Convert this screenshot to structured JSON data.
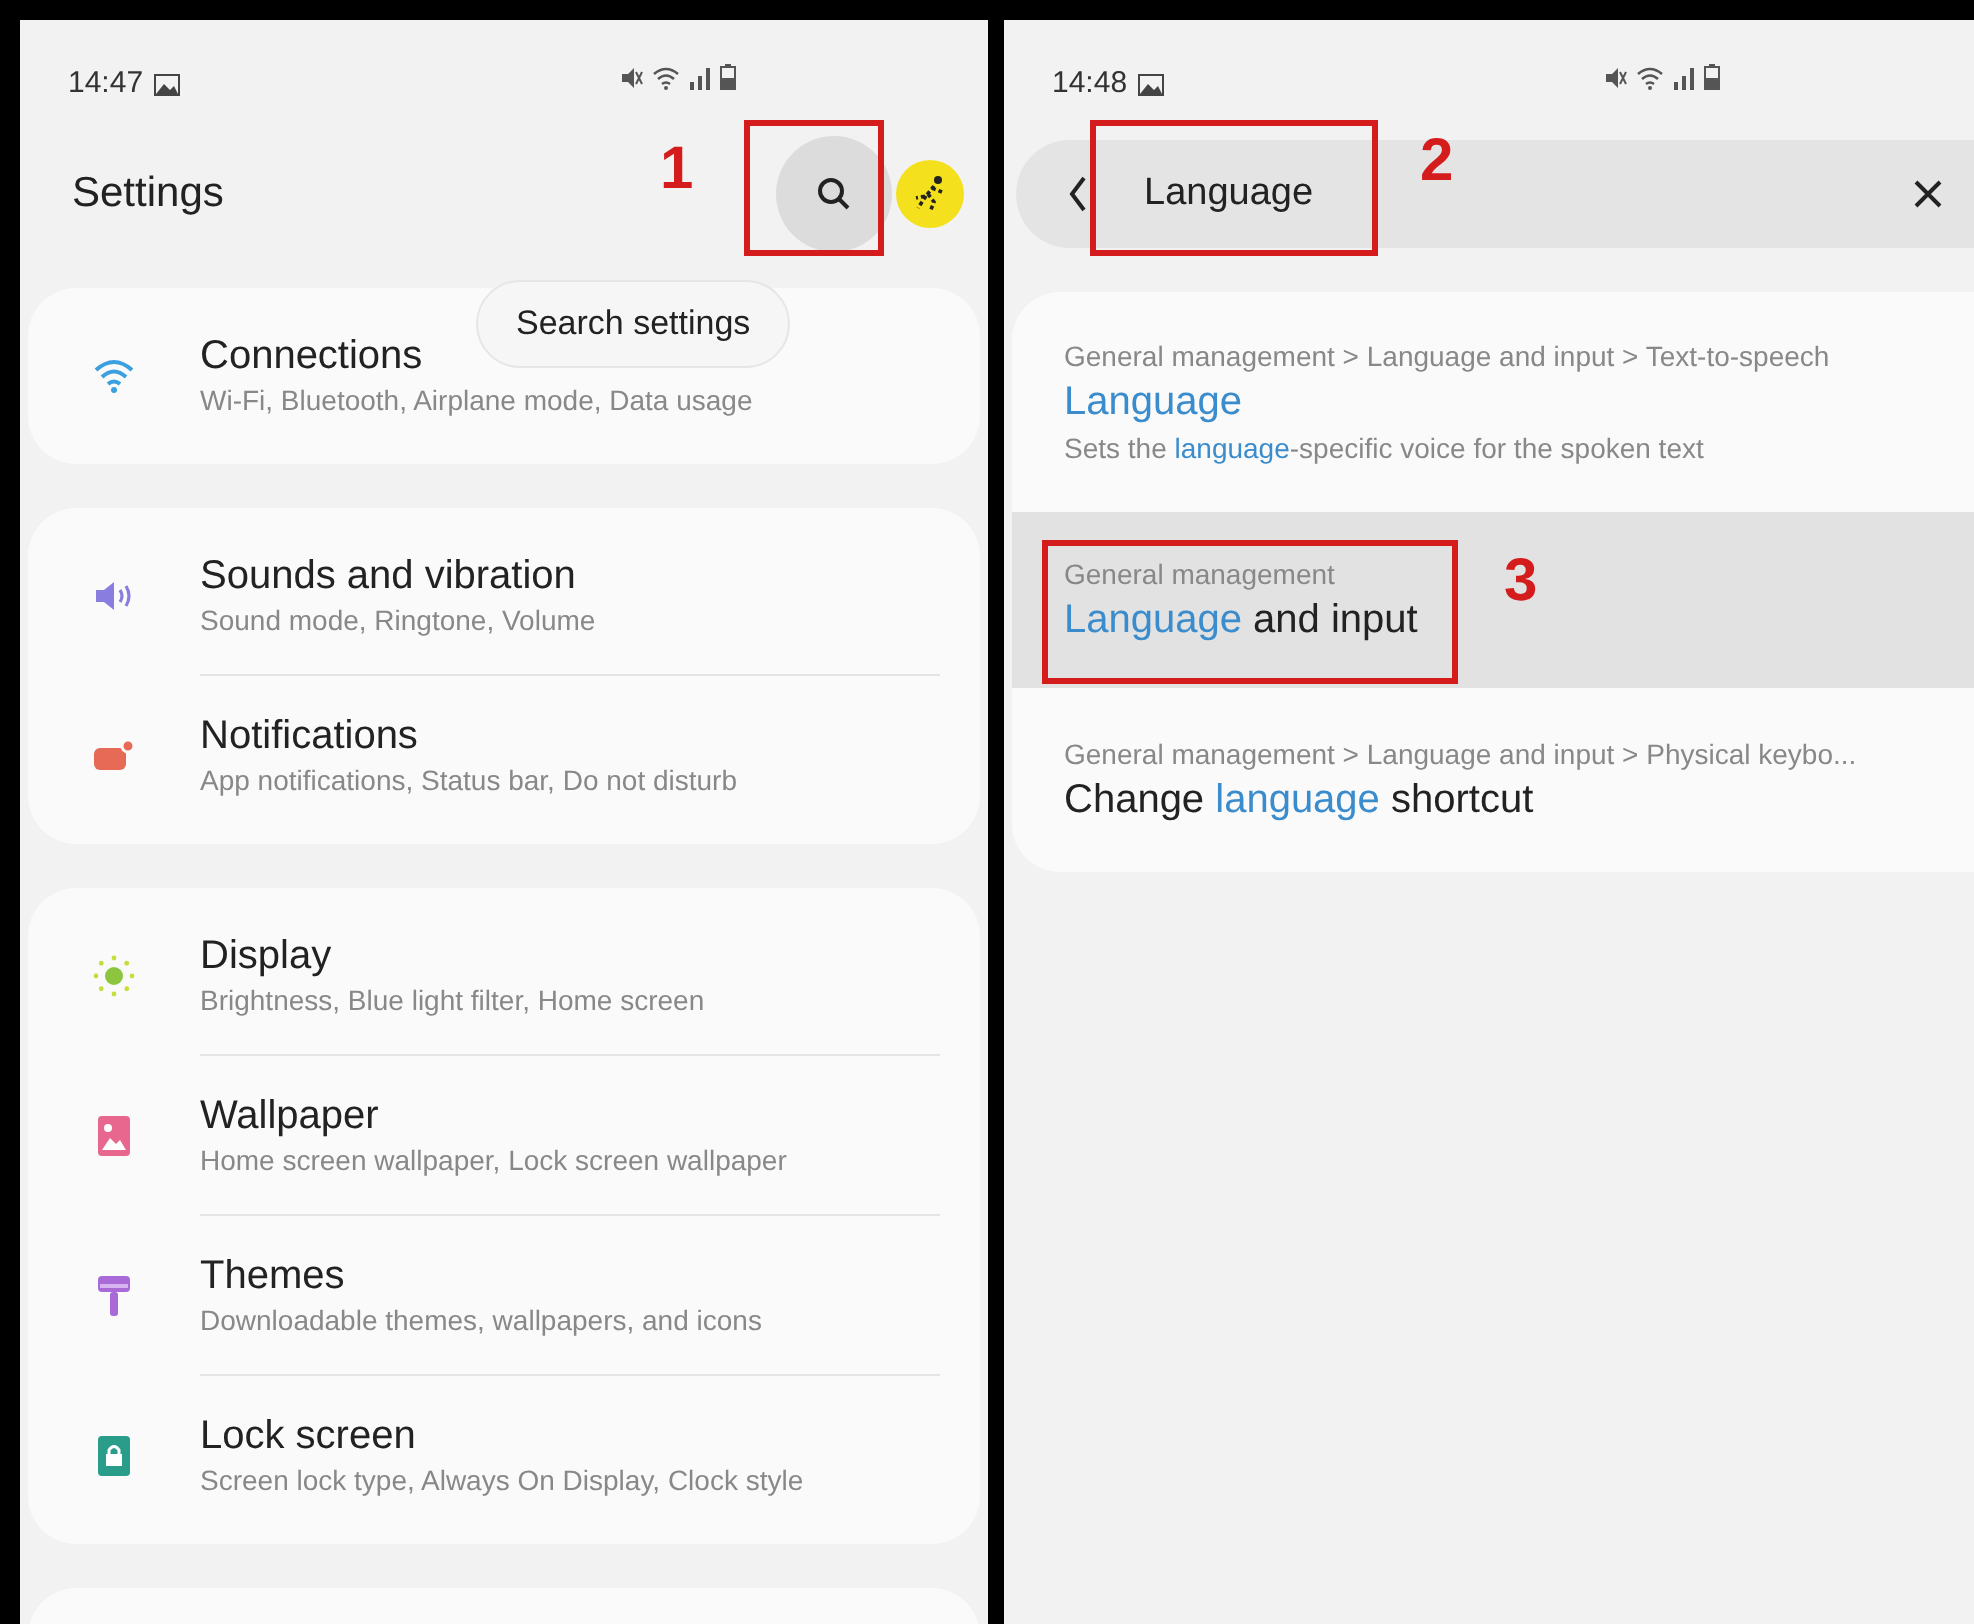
{
  "left": {
    "status_bar": {
      "time": "14:47"
    },
    "title": "Settings",
    "tooltip": "Search settings",
    "groups": [
      [
        {
          "kind": "wifi",
          "title": "Connections",
          "subtitle": "Wi-Fi, Bluetooth, Airplane mode, Data usage"
        }
      ],
      [
        {
          "kind": "sound",
          "title": "Sounds and vibration",
          "subtitle": "Sound mode, Ringtone, Volume"
        },
        {
          "kind": "notification",
          "title": "Notifications",
          "subtitle": "App notifications, Status bar, Do not disturb"
        }
      ],
      [
        {
          "kind": "display",
          "title": "Display",
          "subtitle": "Brightness, Blue light filter, Home screen"
        },
        {
          "kind": "wallpaper",
          "title": "Wallpaper",
          "subtitle": "Home screen wallpaper, Lock screen wallpaper"
        },
        {
          "kind": "themes",
          "title": "Themes",
          "subtitle": "Downloadable themes, wallpapers, and icons"
        },
        {
          "kind": "lock",
          "title": "Lock screen",
          "subtitle": "Screen lock type, Always On Display, Clock style"
        }
      ]
    ]
  },
  "right": {
    "status_bar": {
      "time": "14:48"
    },
    "search": {
      "value": "Language"
    },
    "results": [
      {
        "path": "General management > Language and input > Text-to-speech",
        "title": [
          {
            "text": "Language",
            "match": true
          }
        ],
        "description": [
          {
            "text": "Sets the ",
            "match": false
          },
          {
            "text": "language",
            "match": true
          },
          {
            "text": "-specific voice for the spoken text",
            "match": false
          }
        ],
        "selected": false
      },
      {
        "path": "General management",
        "title": [
          {
            "text": "Language",
            "match": true
          },
          {
            "text": " and input",
            "match": false
          }
        ],
        "selected": true
      },
      {
        "path": "General management > Language and input > Physical keybo...",
        "title": [
          {
            "text": "Change ",
            "match": false
          },
          {
            "text": "language",
            "match": true
          },
          {
            "text": " shortcut",
            "match": false
          }
        ],
        "selected": false
      }
    ]
  },
  "annotations": [
    {
      "label": "1"
    },
    {
      "label": "2"
    },
    {
      "label": "3"
    }
  ]
}
